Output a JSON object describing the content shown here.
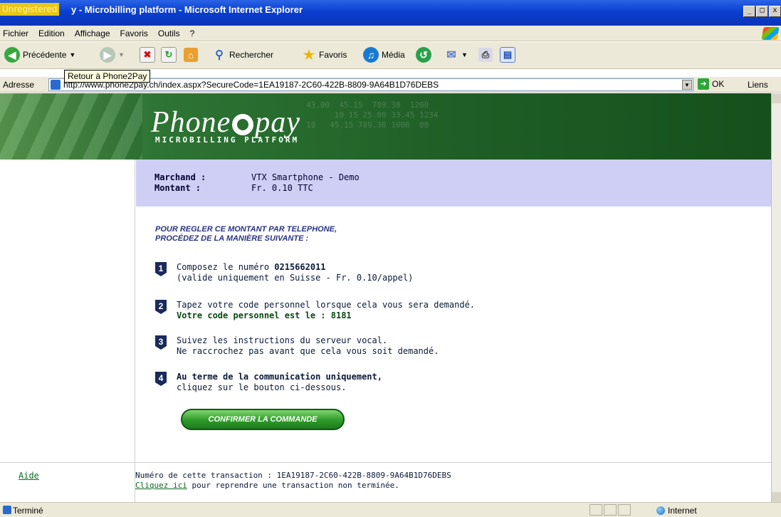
{
  "window": {
    "unregistered_label": "Unregistered",
    "title": "y - Microbilling platform - Microsoft Internet Explorer",
    "btn_min": "_",
    "btn_max": "□",
    "btn_close": "x"
  },
  "menu": [
    "Fichier",
    "Edition",
    "Affichage",
    "Favoris",
    "Outils",
    "?"
  ],
  "toolbar": {
    "back_label": "Précédente",
    "search_label": "Rechercher",
    "favorites_label": "Favoris",
    "media_label": "Média",
    "tooltip": "Retour à Phone2Pay"
  },
  "address": {
    "label": "Adresse",
    "url": "http://www.phone2pay.ch/index.aspx?SecureCode=1EA19187-2C60-422B-8809-9A64B1D76DEBS",
    "go_label": "OK",
    "links_label": "Liens"
  },
  "header": {
    "logo_word_a": "Phone",
    "logo_word_b": "pay",
    "subtitle": "MICROBILLING PLATFORM",
    "bg_numbers": "43.00  45.15  789.30  1200\n      10 15 25.00 33.45 1234\n10   45.15 789.30 1000  00"
  },
  "merchant": {
    "merchant_label": "Marchand :",
    "merchant_value": "VTX Smartphone - Demo",
    "amount_label": "Montant :",
    "amount_value": "Fr. 0.10 TTC"
  },
  "instructions": {
    "title_line1": "POUR REGLER CE MONTANT PAR TELEPHONE,",
    "title_line2": "PROCÉDEZ DE LA MANIÈRE SUIVANTE :",
    "steps": [
      {
        "num": "1",
        "line1_prefix": "Composez le numéro ",
        "line1_bold": "0215662011",
        "line2": "(valide uniquement en Suisse - Fr. 0.10/appel)"
      },
      {
        "num": "2",
        "line1": "Tapez votre code personnel lorsque cela vous sera demandé.",
        "line2_bold": "Votre code personnel est le : 8181"
      },
      {
        "num": "3",
        "line1": "Suivez les instructions du serveur vocal.",
        "line2": "Ne raccrochez pas avant que cela vous soit demandé."
      },
      {
        "num": "4",
        "line1_bold": "Au terme de la communication uniquement,",
        "line2": "cliquez sur le bouton ci-dessous."
      }
    ],
    "confirm_button": "CONFIRMER LA COMMANDE"
  },
  "footer": {
    "help_link": "Aide",
    "transaction_label": "Numéro de cette transaction : 1EA19187-2C60-422B-8809-9A64B1D76DEBS",
    "resume_link": "Cliquez ici",
    "resume_text": " pour reprendre une transaction non terminée."
  },
  "status": {
    "text": "Terminé",
    "zone": "Internet"
  }
}
